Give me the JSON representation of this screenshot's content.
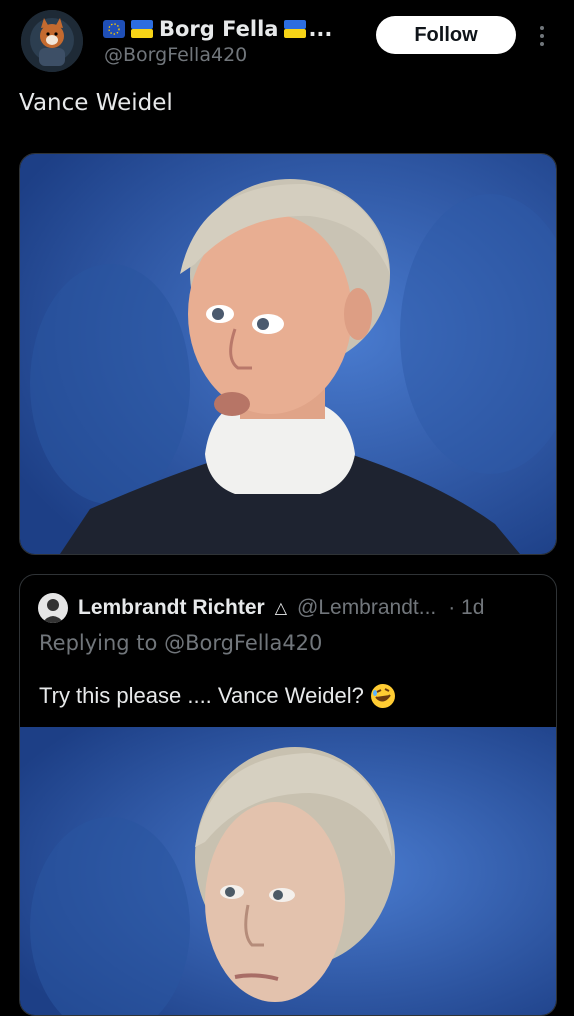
{
  "author": {
    "display_name": "Borg Fella",
    "truncation": "...",
    "handle": "@BorgFella420",
    "flags": [
      "eu-flag-icon",
      "ukraine-flag-icon",
      "ukraine-flag-icon"
    ]
  },
  "follow_label": "Follow",
  "tweet": {
    "text": "Vance Weidel",
    "media_alt": "edited-portrait-photo"
  },
  "quote": {
    "display_name": "Lembrandt Richter",
    "badge": "△",
    "handle": "@Lembrandt...",
    "time": "· 1d",
    "replying_prefix": "Replying to ",
    "replying_handle": "@BorgFella420",
    "text": "Try this please .... Vance Weidel?",
    "emoji": "rolling-on-floor-laughing-icon"
  },
  "colors": {
    "background": "#000000",
    "primary_text": "#e7e9ea",
    "secondary_text": "#71767b",
    "follow_bg": "#ffffff",
    "photo_backdrop": "#2a5aa8"
  }
}
